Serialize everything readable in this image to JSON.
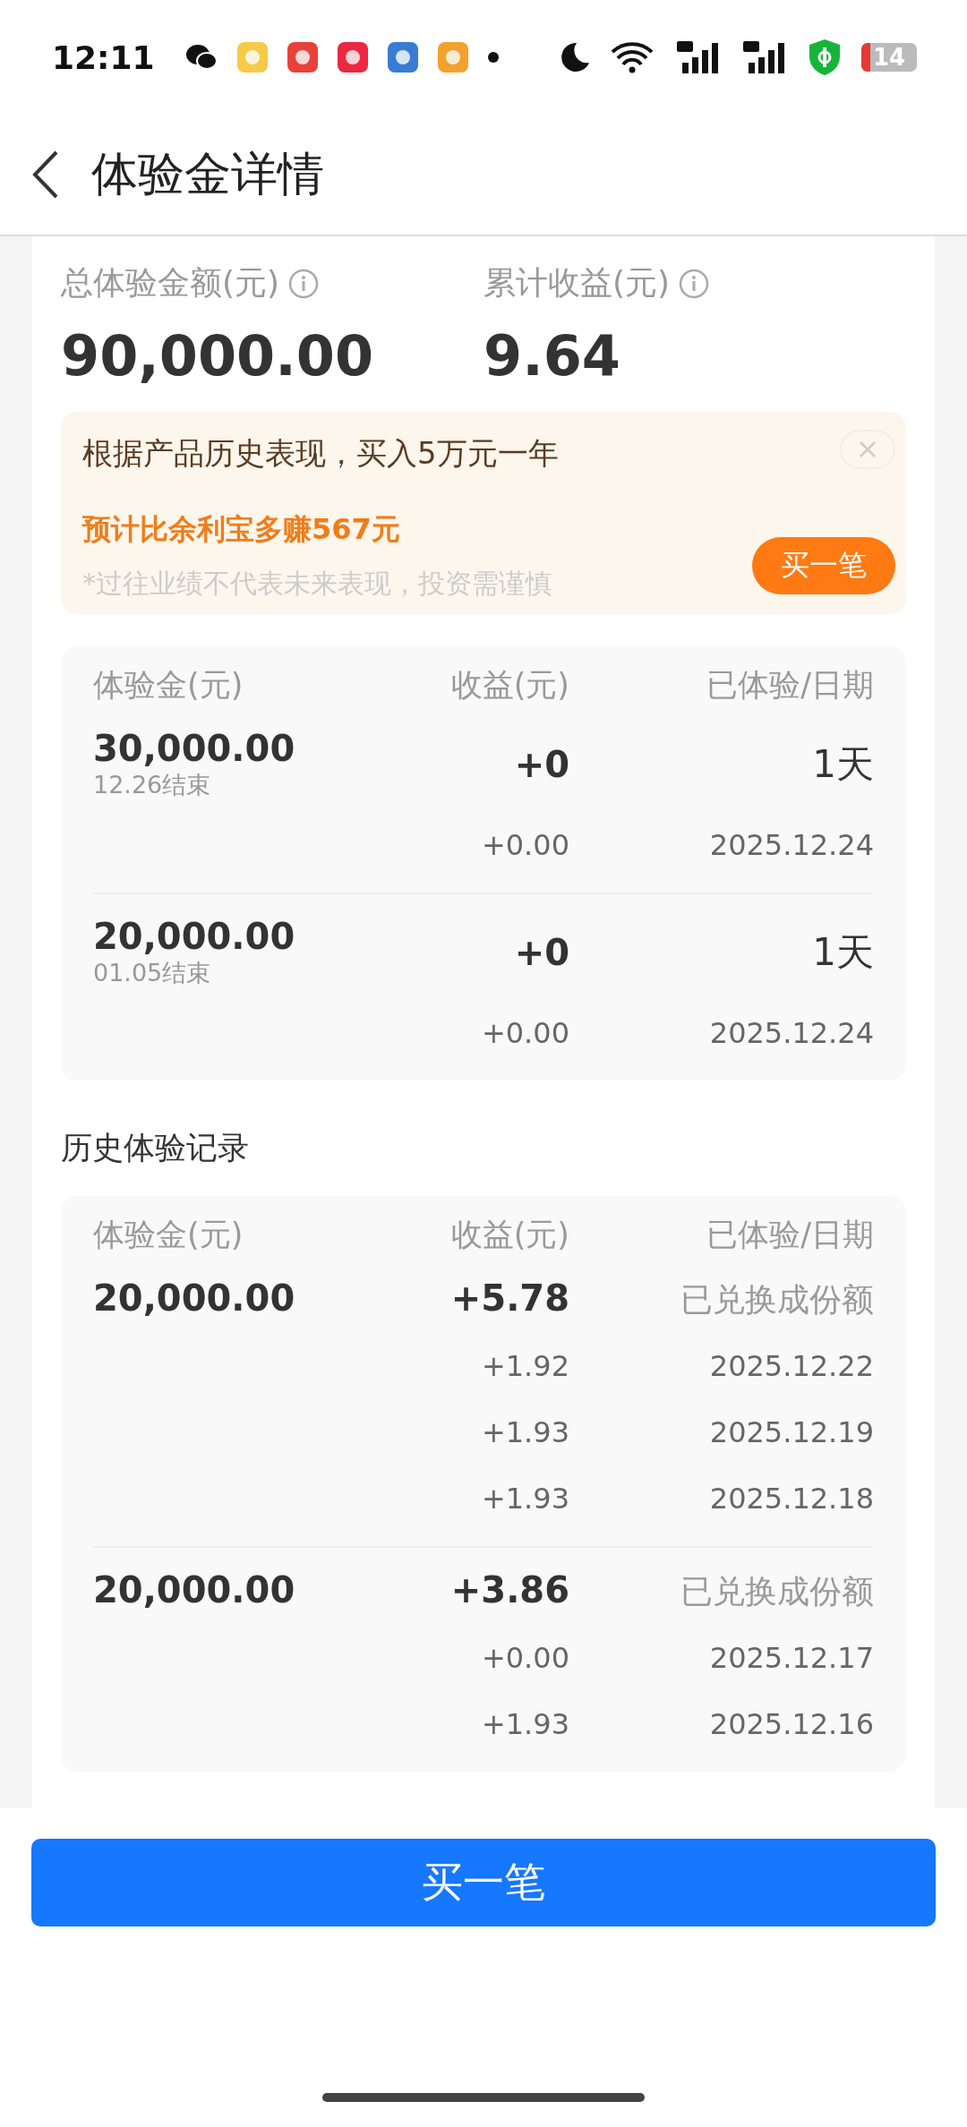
{
  "status_bar": {
    "time": "12:11",
    "battery": "14"
  },
  "header": {
    "title": "体验金详情"
  },
  "summary": [
    {
      "label": "总体验金额(元)",
      "value": "90,000.00"
    },
    {
      "label": "累计收益(元)",
      "value": "9.64"
    }
  ],
  "banner": {
    "text": "根据产品历史表现，买入5万元一年",
    "highlight": "预计比余利宝多赚567元",
    "disclaimer": "*过往业绩不代表未来表现，投资需谨慎",
    "button": "买一笔"
  },
  "current": {
    "columns": [
      "体验金(元)",
      "收益(元)",
      "已体验/日期"
    ],
    "records": [
      {
        "amount": "30,000.00",
        "note": "12.26结束",
        "gain": "+0",
        "status": "1天",
        "details": [
          {
            "gain": "+0.00",
            "date": "2025.12.24"
          }
        ]
      },
      {
        "amount": "20,000.00",
        "note": "01.05结束",
        "gain": "+0",
        "status": "1天",
        "details": [
          {
            "gain": "+0.00",
            "date": "2025.12.24"
          }
        ]
      }
    ]
  },
  "history": {
    "title": "历史体验记录",
    "columns": [
      "体验金(元)",
      "收益(元)",
      "已体验/日期"
    ],
    "records": [
      {
        "amount": "20,000.00",
        "gain": "+5.78",
        "status": "已兑换成份额",
        "details": [
          {
            "gain": "+1.92",
            "date": "2025.12.22"
          },
          {
            "gain": "+1.93",
            "date": "2025.12.19"
          },
          {
            "gain": "+1.93",
            "date": "2025.12.18"
          }
        ]
      },
      {
        "amount": "20,000.00",
        "gain": "+3.86",
        "status": "已兑换成份额",
        "details": [
          {
            "gain": "+0.00",
            "date": "2025.12.17"
          },
          {
            "gain": "+1.93",
            "date": "2025.12.16"
          }
        ]
      }
    ]
  },
  "buy_button": "买一笔"
}
